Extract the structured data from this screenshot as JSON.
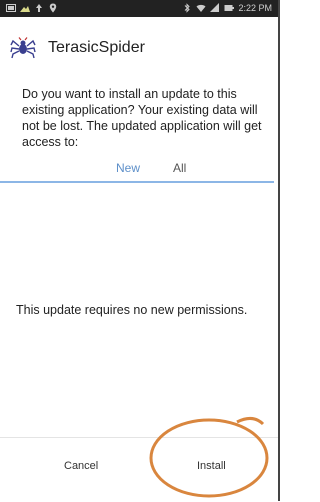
{
  "status_bar": {
    "time": "2:22 PM",
    "left_icons": [
      "gallery-icon",
      "image-icon",
      "upload-icon",
      "location-icon"
    ],
    "right_icons": [
      "bluetooth-icon",
      "wifi-icon",
      "signal-icon",
      "battery-icon"
    ]
  },
  "app": {
    "name": "TerasicSpider",
    "icon": "spider-icon"
  },
  "message": "Do you want to install an update to this existing application? Your existing data will not be lost. The updated application will get access to:",
  "tabs": [
    {
      "label": "New",
      "selected": true
    },
    {
      "label": "All",
      "selected": false
    }
  ],
  "permissions_text": "This update requires no new permissions.",
  "buttons": {
    "cancel": "Cancel",
    "install": "Install"
  },
  "colors": {
    "accent": "#5d8fc9",
    "highlight_ring": "#d9863e"
  }
}
